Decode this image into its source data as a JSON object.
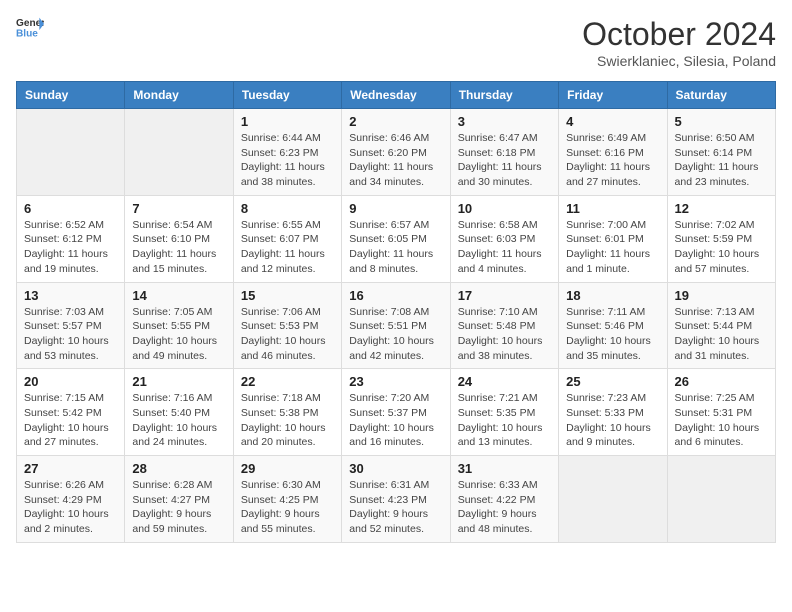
{
  "header": {
    "logo": {
      "general": "General",
      "blue": "Blue"
    },
    "title": "October 2024",
    "subtitle": "Swierklaniec, Silesia, Poland"
  },
  "calendar": {
    "weekdays": [
      "Sunday",
      "Monday",
      "Tuesday",
      "Wednesday",
      "Thursday",
      "Friday",
      "Saturday"
    ],
    "weeks": [
      [
        {
          "day": "",
          "info": ""
        },
        {
          "day": "",
          "info": ""
        },
        {
          "day": "1",
          "info": "Sunrise: 6:44 AM\nSunset: 6:23 PM\nDaylight: 11 hours and 38 minutes."
        },
        {
          "day": "2",
          "info": "Sunrise: 6:46 AM\nSunset: 6:20 PM\nDaylight: 11 hours and 34 minutes."
        },
        {
          "day": "3",
          "info": "Sunrise: 6:47 AM\nSunset: 6:18 PM\nDaylight: 11 hours and 30 minutes."
        },
        {
          "day": "4",
          "info": "Sunrise: 6:49 AM\nSunset: 6:16 PM\nDaylight: 11 hours and 27 minutes."
        },
        {
          "day": "5",
          "info": "Sunrise: 6:50 AM\nSunset: 6:14 PM\nDaylight: 11 hours and 23 minutes."
        }
      ],
      [
        {
          "day": "6",
          "info": "Sunrise: 6:52 AM\nSunset: 6:12 PM\nDaylight: 11 hours and 19 minutes."
        },
        {
          "day": "7",
          "info": "Sunrise: 6:54 AM\nSunset: 6:10 PM\nDaylight: 11 hours and 15 minutes."
        },
        {
          "day": "8",
          "info": "Sunrise: 6:55 AM\nSunset: 6:07 PM\nDaylight: 11 hours and 12 minutes."
        },
        {
          "day": "9",
          "info": "Sunrise: 6:57 AM\nSunset: 6:05 PM\nDaylight: 11 hours and 8 minutes."
        },
        {
          "day": "10",
          "info": "Sunrise: 6:58 AM\nSunset: 6:03 PM\nDaylight: 11 hours and 4 minutes."
        },
        {
          "day": "11",
          "info": "Sunrise: 7:00 AM\nSunset: 6:01 PM\nDaylight: 11 hours and 1 minute."
        },
        {
          "day": "12",
          "info": "Sunrise: 7:02 AM\nSunset: 5:59 PM\nDaylight: 10 hours and 57 minutes."
        }
      ],
      [
        {
          "day": "13",
          "info": "Sunrise: 7:03 AM\nSunset: 5:57 PM\nDaylight: 10 hours and 53 minutes."
        },
        {
          "day": "14",
          "info": "Sunrise: 7:05 AM\nSunset: 5:55 PM\nDaylight: 10 hours and 49 minutes."
        },
        {
          "day": "15",
          "info": "Sunrise: 7:06 AM\nSunset: 5:53 PM\nDaylight: 10 hours and 46 minutes."
        },
        {
          "day": "16",
          "info": "Sunrise: 7:08 AM\nSunset: 5:51 PM\nDaylight: 10 hours and 42 minutes."
        },
        {
          "day": "17",
          "info": "Sunrise: 7:10 AM\nSunset: 5:48 PM\nDaylight: 10 hours and 38 minutes."
        },
        {
          "day": "18",
          "info": "Sunrise: 7:11 AM\nSunset: 5:46 PM\nDaylight: 10 hours and 35 minutes."
        },
        {
          "day": "19",
          "info": "Sunrise: 7:13 AM\nSunset: 5:44 PM\nDaylight: 10 hours and 31 minutes."
        }
      ],
      [
        {
          "day": "20",
          "info": "Sunrise: 7:15 AM\nSunset: 5:42 PM\nDaylight: 10 hours and 27 minutes."
        },
        {
          "day": "21",
          "info": "Sunrise: 7:16 AM\nSunset: 5:40 PM\nDaylight: 10 hours and 24 minutes."
        },
        {
          "day": "22",
          "info": "Sunrise: 7:18 AM\nSunset: 5:38 PM\nDaylight: 10 hours and 20 minutes."
        },
        {
          "day": "23",
          "info": "Sunrise: 7:20 AM\nSunset: 5:37 PM\nDaylight: 10 hours and 16 minutes."
        },
        {
          "day": "24",
          "info": "Sunrise: 7:21 AM\nSunset: 5:35 PM\nDaylight: 10 hours and 13 minutes."
        },
        {
          "day": "25",
          "info": "Sunrise: 7:23 AM\nSunset: 5:33 PM\nDaylight: 10 hours and 9 minutes."
        },
        {
          "day": "26",
          "info": "Sunrise: 7:25 AM\nSunset: 5:31 PM\nDaylight: 10 hours and 6 minutes."
        }
      ],
      [
        {
          "day": "27",
          "info": "Sunrise: 6:26 AM\nSunset: 4:29 PM\nDaylight: 10 hours and 2 minutes."
        },
        {
          "day": "28",
          "info": "Sunrise: 6:28 AM\nSunset: 4:27 PM\nDaylight: 9 hours and 59 minutes."
        },
        {
          "day": "29",
          "info": "Sunrise: 6:30 AM\nSunset: 4:25 PM\nDaylight: 9 hours and 55 minutes."
        },
        {
          "day": "30",
          "info": "Sunrise: 6:31 AM\nSunset: 4:23 PM\nDaylight: 9 hours and 52 minutes."
        },
        {
          "day": "31",
          "info": "Sunrise: 6:33 AM\nSunset: 4:22 PM\nDaylight: 9 hours and 48 minutes."
        },
        {
          "day": "",
          "info": ""
        },
        {
          "day": "",
          "info": ""
        }
      ]
    ]
  }
}
